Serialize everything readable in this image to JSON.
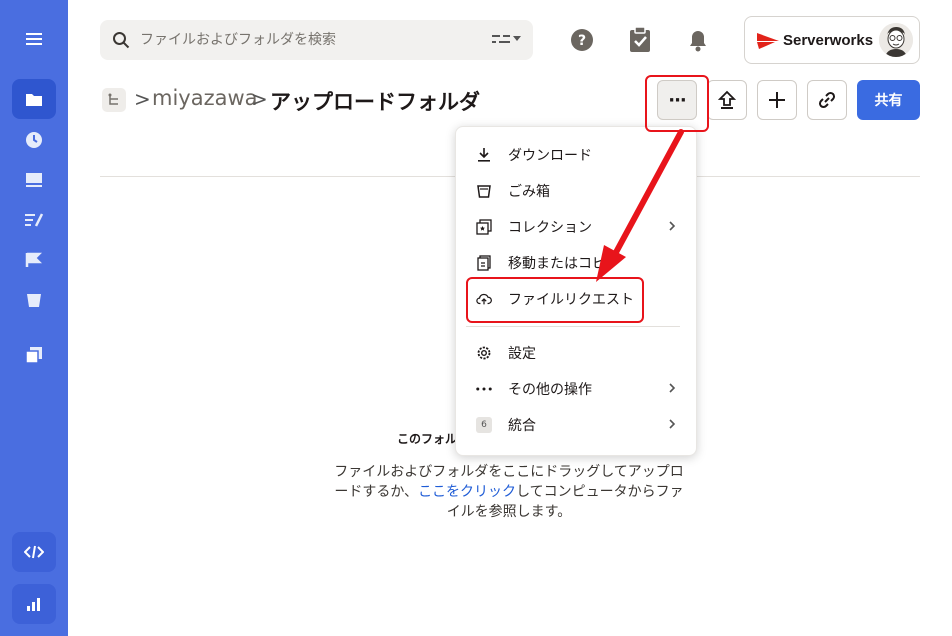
{
  "sidebar": {
    "items": [
      {
        "name": "menu-icon"
      },
      {
        "name": "folder-icon"
      },
      {
        "name": "clock-icon"
      },
      {
        "name": "photos-icon"
      },
      {
        "name": "signature-icon"
      },
      {
        "name": "flag-icon"
      },
      {
        "name": "trash-icon"
      },
      {
        "name": "collections-icon"
      },
      {
        "name": "code-icon"
      },
      {
        "name": "analytics-icon"
      }
    ]
  },
  "search": {
    "placeholder": "ファイルおよびフォルダを検索"
  },
  "account": {
    "brand": "Serverworks"
  },
  "breadcrumb": {
    "parent": "miyazawa",
    "current": "アップロードフォルダ",
    "separator": ">"
  },
  "actions": {
    "more_icon": "···",
    "share_label": "共有"
  },
  "menu": {
    "items": [
      {
        "label": "ダウンロード",
        "icon": "download-icon"
      },
      {
        "label": "ごみ箱",
        "icon": "trash-icon"
      },
      {
        "label": "コレクション",
        "icon": "collection-icon",
        "submenu": true
      },
      {
        "label": "移動またはコピー",
        "icon": "copy-icon"
      },
      {
        "label": "ファイルリクエスト",
        "icon": "cloud-upload-icon"
      },
      {
        "label": "設定",
        "icon": "gear-icon"
      },
      {
        "label": "その他の操作",
        "icon": "more-horizontal-icon",
        "submenu": true
      },
      {
        "label": "統合",
        "icon": "integration-icon",
        "badge": "6",
        "submenu": true
      }
    ]
  },
  "empty_state": {
    "title": "このフォル",
    "desc_before": "ファイルおよびフォルダをここにドラッグしてアップロードするか、",
    "desc_link": "ここをクリック",
    "desc_after": "してコンピュータからファイルを参照します。"
  },
  "colors": {
    "sidebar": "#4a6ee0",
    "primary": "#3a6be1",
    "annotation": "#e8141b"
  }
}
